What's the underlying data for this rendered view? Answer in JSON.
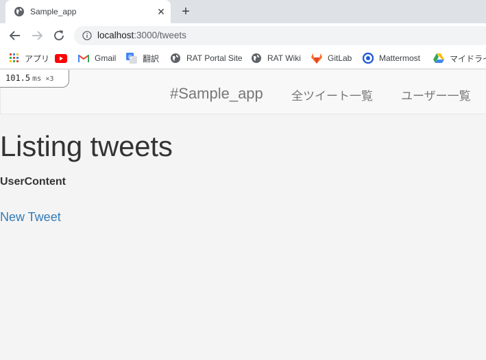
{
  "browser": {
    "tab": {
      "title": "Sample_app"
    },
    "url": {
      "host": "localhost",
      "path": ":3000/tweets"
    },
    "bookmarks": [
      {
        "label": "アプリ",
        "icon": "apps-grid-icon"
      },
      {
        "label": "",
        "icon": "youtube-icon"
      },
      {
        "label": "Gmail",
        "icon": "gmail-icon"
      },
      {
        "label": "翻訳",
        "icon": "translate-icon"
      },
      {
        "label": "RAT Portal Site",
        "icon": "globe-icon"
      },
      {
        "label": "RAT Wiki",
        "icon": "globe-icon"
      },
      {
        "label": "GitLab",
        "icon": "gitlab-icon"
      },
      {
        "label": "Mattermost",
        "icon": "mattermost-icon"
      },
      {
        "label": "マイドライブ",
        "icon": "google-drive-icon"
      }
    ]
  },
  "profiler": {
    "time": "101.5",
    "unit": "ms",
    "count": "×3"
  },
  "navbar": {
    "brand": "#Sample_app",
    "links": [
      "全ツイート一覧",
      "ユーザー一覧"
    ]
  },
  "main": {
    "title": "Listing tweets",
    "user_content": "UserContent",
    "new_tweet": "New Tweet"
  },
  "colors": {
    "link": "#337ab7",
    "text": "#333333",
    "navbar_text": "#777777"
  }
}
